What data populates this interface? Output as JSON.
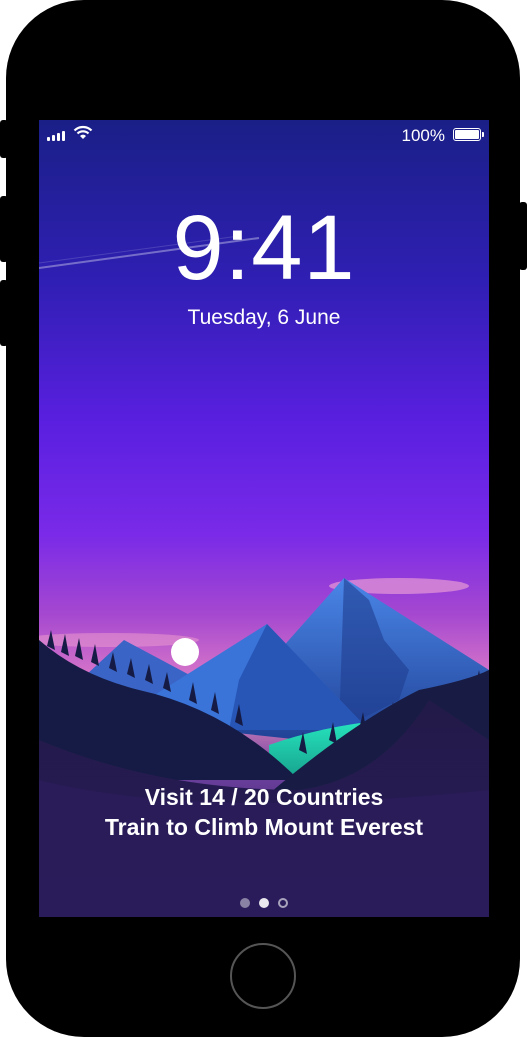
{
  "status_bar": {
    "battery_percent": "100%",
    "signal_bars": 4,
    "wifi": "wifi-icon",
    "battery_icon": "battery-full-icon"
  },
  "lock_screen": {
    "time": "9:41",
    "date": "Tuesday, 6 June"
  },
  "notification": {
    "line1": "Visit 14 / 20 Countries",
    "line2": "Train to Climb Mount Everest"
  },
  "page_indicator": {
    "count": 3,
    "active_index": 1,
    "last_icon": "camera-icon"
  },
  "colors": {
    "sky_top": "#1a1f87",
    "sky_mid": "#7a2ae8",
    "horizon_pink": "#e08ac0",
    "mountain_blue": "#3a6fd0",
    "glow_teal": "#27e8c0"
  }
}
